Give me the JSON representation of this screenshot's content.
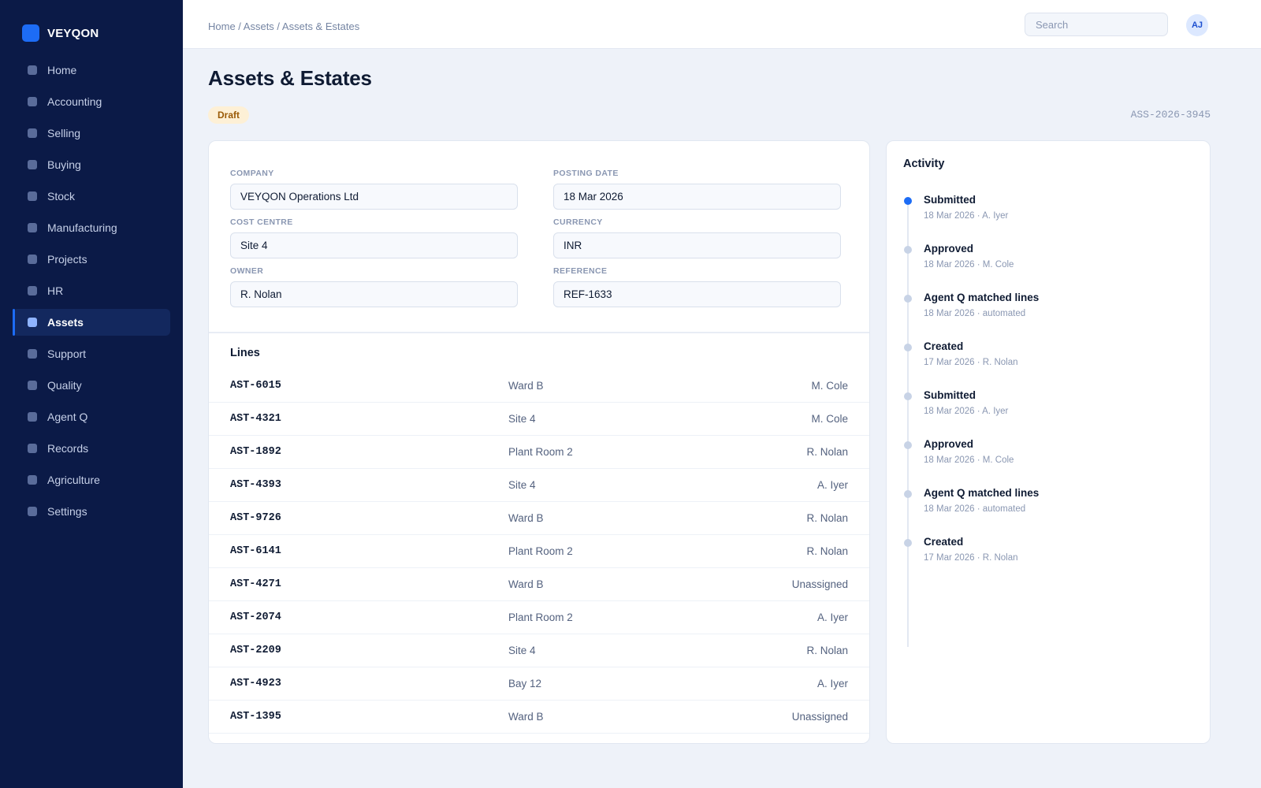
{
  "app": {
    "name": "VEYQON"
  },
  "sidebar": {
    "items": [
      {
        "label": "Home",
        "active": false
      },
      {
        "label": "Accounting",
        "active": false
      },
      {
        "label": "Selling",
        "active": false
      },
      {
        "label": "Buying",
        "active": false
      },
      {
        "label": "Stock",
        "active": false
      },
      {
        "label": "Manufacturing",
        "active": false
      },
      {
        "label": "Projects",
        "active": false
      },
      {
        "label": "HR",
        "active": false
      },
      {
        "label": "Assets",
        "active": true
      },
      {
        "label": "Support",
        "active": false
      },
      {
        "label": "Quality",
        "active": false
      },
      {
        "label": "Agent Q",
        "active": false
      },
      {
        "label": "Records",
        "active": false
      },
      {
        "label": "Agriculture",
        "active": false
      },
      {
        "label": "Settings",
        "active": false
      }
    ]
  },
  "header": {
    "breadcrumb": "Home / Assets / Assets & Estates",
    "search_placeholder": "Search",
    "search_value": "",
    "avatar_initials": "AJ"
  },
  "page": {
    "title": "Assets & Estates",
    "status": "Draft",
    "doc_id": "ASS-2026-3945"
  },
  "form": {
    "company": {
      "label": "Company",
      "value": "VEYQON Operations Ltd"
    },
    "posting_date": {
      "label": "Posting Date",
      "value": "18 Mar 2026"
    },
    "cost_centre": {
      "label": "Cost Centre",
      "value": "Site 4"
    },
    "currency": {
      "label": "Currency",
      "value": "INR"
    },
    "owner": {
      "label": "Owner",
      "value": "R. Nolan"
    },
    "reference": {
      "label": "Reference",
      "value": "REF-1633"
    }
  },
  "lines": {
    "title": "Lines",
    "rows": [
      {
        "code": "AST-6015",
        "location": "Ward B",
        "owner": "M. Cole"
      },
      {
        "code": "AST-4321",
        "location": "Site 4",
        "owner": "M. Cole"
      },
      {
        "code": "AST-1892",
        "location": "Plant Room 2",
        "owner": "R. Nolan"
      },
      {
        "code": "AST-4393",
        "location": "Site 4",
        "owner": "A. Iyer"
      },
      {
        "code": "AST-9726",
        "location": "Ward B",
        "owner": "R. Nolan"
      },
      {
        "code": "AST-6141",
        "location": "Plant Room 2",
        "owner": "R. Nolan"
      },
      {
        "code": "AST-4271",
        "location": "Ward B",
        "owner": "Unassigned"
      },
      {
        "code": "AST-2074",
        "location": "Plant Room 2",
        "owner": "A. Iyer"
      },
      {
        "code": "AST-2209",
        "location": "Site 4",
        "owner": "R. Nolan"
      },
      {
        "code": "AST-4923",
        "location": "Bay 12",
        "owner": "A. Iyer"
      },
      {
        "code": "AST-1395",
        "location": "Ward B",
        "owner": "Unassigned"
      }
    ]
  },
  "activity": {
    "title": "Activity",
    "events": [
      {
        "title": "Submitted",
        "meta": "18 Mar 2026 · A. Iyer",
        "current": true
      },
      {
        "title": "Approved",
        "meta": "18 Mar 2026 · M. Cole",
        "current": false
      },
      {
        "title": "Agent Q matched lines",
        "meta": "18 Mar 2026 · automated",
        "current": false
      },
      {
        "title": "Created",
        "meta": "17 Mar 2026 · R. Nolan",
        "current": false
      },
      {
        "title": "Submitted",
        "meta": "18 Mar 2026 · A. Iyer",
        "current": false
      },
      {
        "title": "Approved",
        "meta": "18 Mar 2026 · M. Cole",
        "current": false
      },
      {
        "title": "Agent Q matched lines",
        "meta": "18 Mar 2026 · automated",
        "current": false
      },
      {
        "title": "Created",
        "meta": "17 Mar 2026 · R. Nolan",
        "current": false
      }
    ]
  }
}
